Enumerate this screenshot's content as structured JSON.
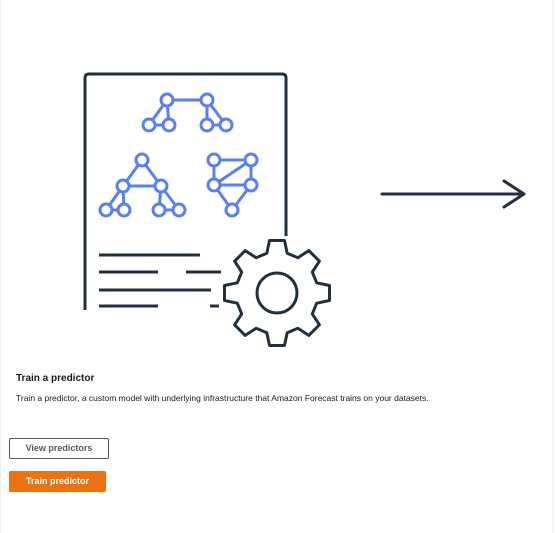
{
  "card": {
    "title": "Train a predictor",
    "description": "Train a predictor, a custom model with underlying infrastructure that Amazon Forecast trains on your datasets."
  },
  "actions": {
    "secondary_label": "View predictors",
    "primary_label": "Train predictor"
  },
  "illustration": {
    "icons": [
      "document-icon",
      "network-graph-icon",
      "gear-icon",
      "arrow-right-icon"
    ]
  },
  "colors": {
    "accent": "#ec7211",
    "graph": "#5a7ff5",
    "ink": "#232f3e",
    "text": "#16191f"
  }
}
